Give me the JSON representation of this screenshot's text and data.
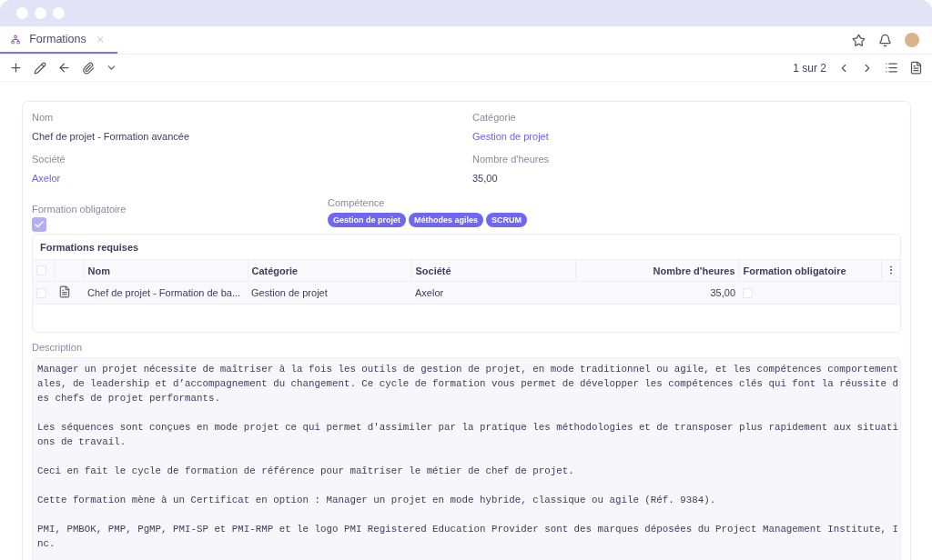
{
  "tab": {
    "label": "Formations",
    "selected": true
  },
  "pager": {
    "text": "1 sur 2"
  },
  "fields": {
    "nom": {
      "label": "Nom",
      "value": "Chef de projet - Formation avancée"
    },
    "categorie": {
      "label": "Catégorie",
      "value": "Gestion de projet"
    },
    "societe": {
      "label": "Société",
      "value": "Axelor"
    },
    "heures": {
      "label": "Nombre d'heures",
      "value": "35,00"
    },
    "obligatoire": {
      "label": "Formation obligatoire",
      "checked": true
    },
    "competence": {
      "label": "Compétence",
      "tags": [
        "Gestion de projet",
        "Méthodes agiles",
        "SCRUM"
      ]
    }
  },
  "table": {
    "title": "Formations requises",
    "all_selected": false,
    "columns": [
      {
        "label": "Nom",
        "kind": "text"
      },
      {
        "label": "Catégorie",
        "kind": "text"
      },
      {
        "label": "Société",
        "kind": "text"
      },
      {
        "label": "Nombre d'heures",
        "kind": "number"
      },
      {
        "label": "Formation obligatoire",
        "kind": "text"
      }
    ],
    "rows": [
      {
        "selected": false,
        "cells": [
          "Chef de projet - Formation de ba...",
          "Gestion de projet",
          "Axelor",
          "35,00"
        ],
        "obligatoire": false
      }
    ]
  },
  "description": {
    "label": "Description",
    "paragraphs": [
      "Manager un projet nécessite de maîtriser à la fois les outils de gestion de projet, en mode traditionnel ou agile, et les compétences comportementales, de leadership et d’accompagnement du changement. Ce cycle de formation vous permet de développer les compétences clés qui font la réussite des chefs de projet performants.",
      "Les séquences sont conçues en mode projet ce qui permet d'assimiler par la pratique les méthodologies et de transposer plus rapidement aux situations de travail.",
      "Ceci en fait le cycle de formation de référence pour maîtriser le métier de chef de projet.",
      "Cette formation mène à un Certificat en option : Manager un projet en mode hybride, classique ou agile (Réf. 9384).",
      "PMI, PMBOK, PMP, PgMP, PMI-SP et PMI-RMP et le logo PMI Registered Education Provider sont des marques déposées du Project Management Institute, Inc."
    ]
  }
}
